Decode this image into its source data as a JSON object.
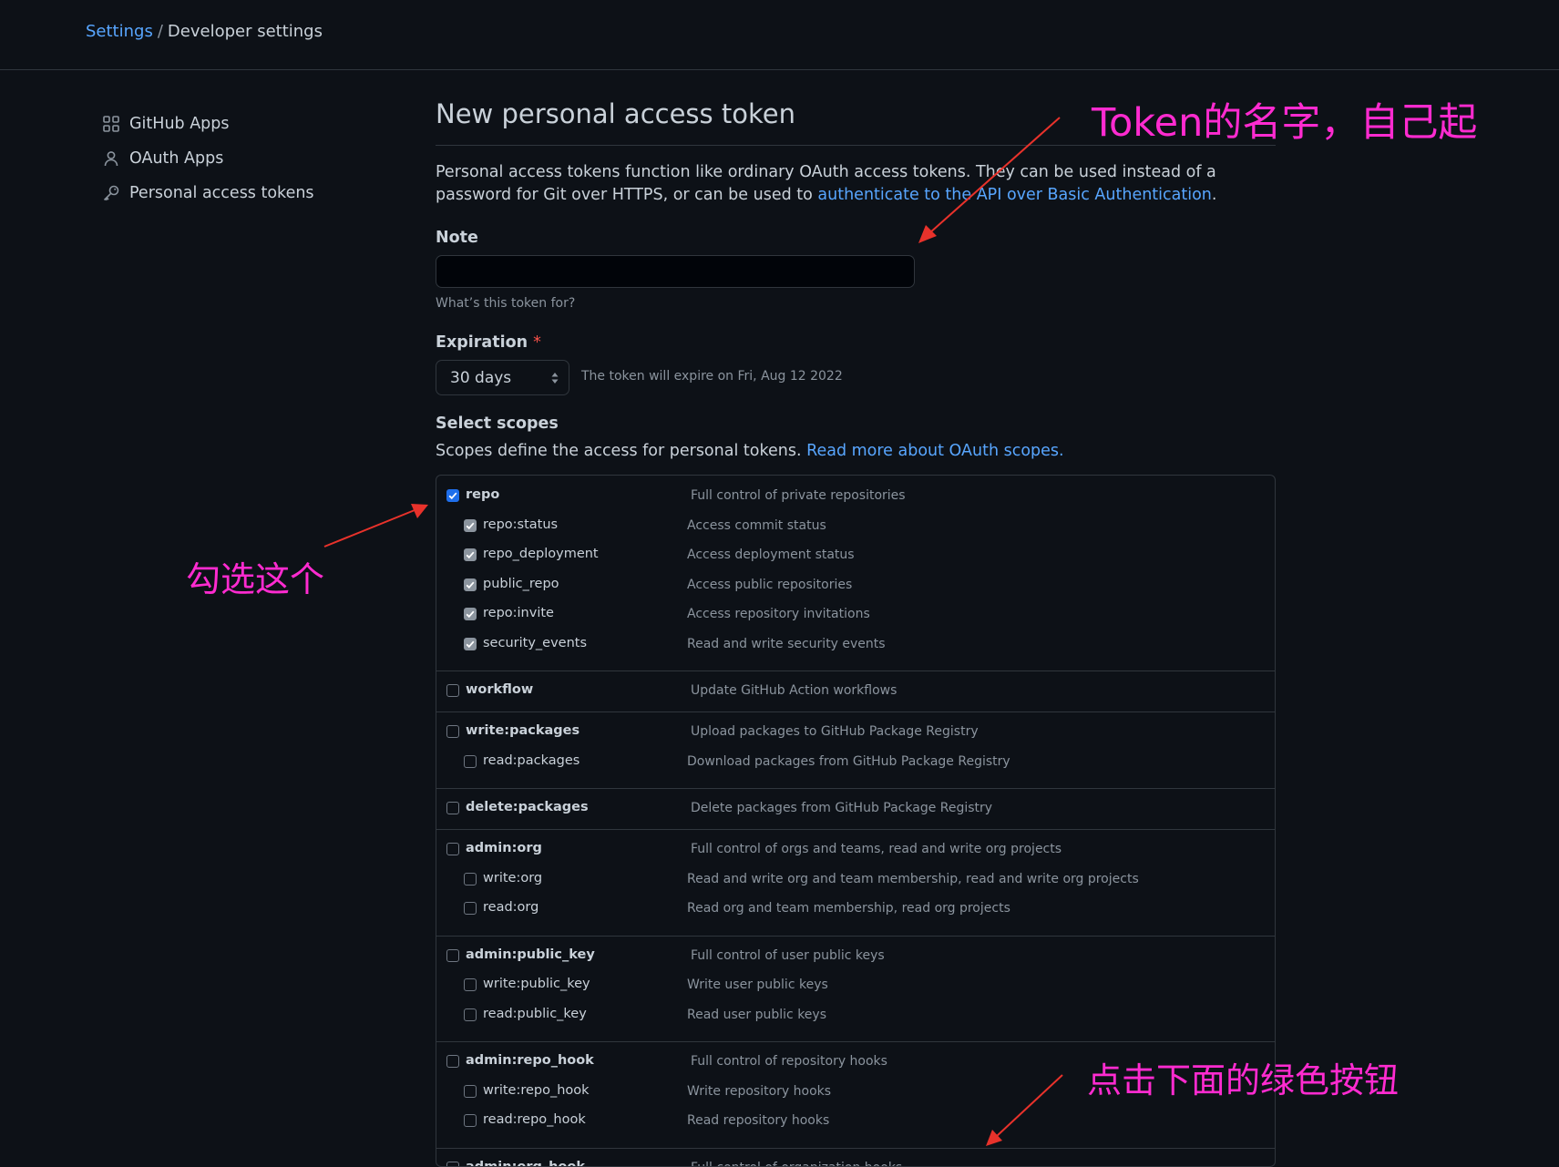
{
  "breadcrumb": {
    "root": "Settings",
    "separator": "/",
    "current": "Developer settings"
  },
  "sidebar": {
    "items": [
      {
        "label": "GitHub Apps",
        "icon": "apps-grid-icon"
      },
      {
        "label": "OAuth Apps",
        "icon": "person-icon"
      },
      {
        "label": "Personal access tokens",
        "icon": "key-icon"
      }
    ]
  },
  "page": {
    "title": "New personal access token",
    "intro_text": "Personal access tokens function like ordinary OAuth access tokens. They can be used instead of a password for Git over HTTPS, or can be used to ",
    "intro_link": "authenticate to the API over Basic Authentication",
    "intro_end": "."
  },
  "note": {
    "label": "Note",
    "value": "",
    "placeholder": "",
    "hint": "What’s this token for?"
  },
  "expiration": {
    "label": "Expiration",
    "required_mark": "*",
    "selected": "30 days",
    "message": "The token will expire on Fri, Aug 12 2022"
  },
  "scopes": {
    "heading": "Select scopes",
    "intro": "Scopes define the access for personal tokens. ",
    "intro_link": "Read more about OAuth scopes.",
    "groups": [
      {
        "name": "repo",
        "desc": "Full control of private repositories",
        "checked": true,
        "children": [
          {
            "name": "repo:status",
            "desc": "Access commit status",
            "checked": true
          },
          {
            "name": "repo_deployment",
            "desc": "Access deployment status",
            "checked": true
          },
          {
            "name": "public_repo",
            "desc": "Access public repositories",
            "checked": true
          },
          {
            "name": "repo:invite",
            "desc": "Access repository invitations",
            "checked": true
          },
          {
            "name": "security_events",
            "desc": "Read and write security events",
            "checked": true
          }
        ]
      },
      {
        "name": "workflow",
        "desc": "Update GitHub Action workflows",
        "checked": false,
        "children": []
      },
      {
        "name": "write:packages",
        "desc": "Upload packages to GitHub Package Registry",
        "checked": false,
        "children": [
          {
            "name": "read:packages",
            "desc": "Download packages from GitHub Package Registry",
            "checked": false
          }
        ]
      },
      {
        "name": "delete:packages",
        "desc": "Delete packages from GitHub Package Registry",
        "checked": false,
        "children": []
      },
      {
        "name": "admin:org",
        "desc": "Full control of orgs and teams, read and write org projects",
        "checked": false,
        "children": [
          {
            "name": "write:org",
            "desc": "Read and write org and team membership, read and write org projects",
            "checked": false
          },
          {
            "name": "read:org",
            "desc": "Read org and team membership, read org projects",
            "checked": false
          }
        ]
      },
      {
        "name": "admin:public_key",
        "desc": "Full control of user public keys",
        "checked": false,
        "children": [
          {
            "name": "write:public_key",
            "desc": "Write user public keys",
            "checked": false
          },
          {
            "name": "read:public_key",
            "desc": "Read user public keys",
            "checked": false
          }
        ]
      },
      {
        "name": "admin:repo_hook",
        "desc": "Full control of repository hooks",
        "checked": false,
        "children": [
          {
            "name": "write:repo_hook",
            "desc": "Write repository hooks",
            "checked": false
          },
          {
            "name": "read:repo_hook",
            "desc": "Read repository hooks",
            "checked": false
          }
        ]
      },
      {
        "name": "admin:org_hook",
        "desc": "Full control of organization hooks",
        "checked": false,
        "children": []
      }
    ]
  },
  "annotations": {
    "token_name": "Token的名字，自己起",
    "check_this": "勾选这个",
    "click_button": "点击下面的绿色按钮",
    "color": "#ff2bd0",
    "arrow_color": "#e8322b"
  },
  "colors": {
    "background": "#0d1117",
    "link": "#58a6ff",
    "border": "#30363d",
    "muted": "#8b949e",
    "checked": "#1f6feb"
  }
}
